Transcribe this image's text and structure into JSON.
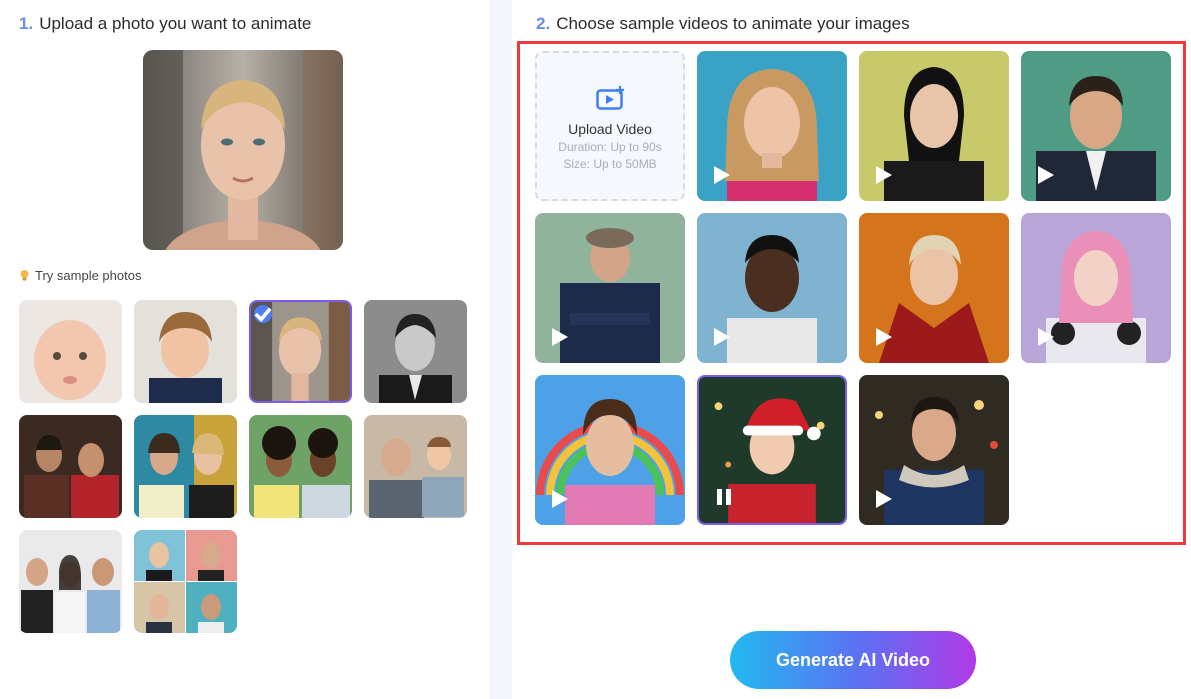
{
  "step1": {
    "number": "1.",
    "title": "Upload a photo you want to animate"
  },
  "step2": {
    "number": "2.",
    "title": "Choose sample videos to animate your images"
  },
  "samples": {
    "label": "Try sample photos",
    "selected_index": 2
  },
  "upload_video": {
    "title": "Upload Video",
    "duration": "Duration: Up to 90s",
    "size": "Size: Up to 50MB",
    "icon": "video-upload-icon"
  },
  "generate_button": {
    "label": "Generate AI Video"
  },
  "colors": {
    "accent": "#6b8cf0",
    "selection": "#7b5cf0",
    "highlight_border": "#f0393c"
  }
}
